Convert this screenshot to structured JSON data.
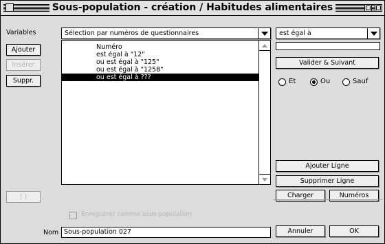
{
  "window": {
    "title": "Sous-population - création / Habitudes alimentaires"
  },
  "left": {
    "variables_label": "Variables",
    "ajouter_label": "Ajouter",
    "inserer_label": "Insérer",
    "suppr_label": "Suppr.",
    "empty_button_label": "( )"
  },
  "selection_popup": {
    "value": "Sélection par numéros de questionnaires"
  },
  "list": {
    "items": [
      "Numéro",
      "est égal à \"12\"",
      "ou est égal à \"125\"",
      "ou est égal à \"1258\"",
      "ou est égal à ???"
    ],
    "selected_index": 4
  },
  "right": {
    "operator_popup": "est égal à",
    "value_field": "",
    "valider_suivant_label": "Valider & Suivant",
    "radios": [
      {
        "label": "Et",
        "selected": false
      },
      {
        "label": "Ou",
        "selected": true
      },
      {
        "label": "Sauf",
        "selected": false
      }
    ],
    "ajouter_ligne_label": "Ajouter Ligne",
    "supprimer_ligne_label": "Supprimer Ligne",
    "charger_label": "Charger",
    "numeros_label": "Numéros",
    "annuler_label": "Annuler",
    "ok_label": "OK"
  },
  "bottom": {
    "save_checkbox_label": "Enregistrer comme sous-population",
    "save_checked": false,
    "nom_label": "Nom",
    "nom_value": "Sous-population 027"
  }
}
